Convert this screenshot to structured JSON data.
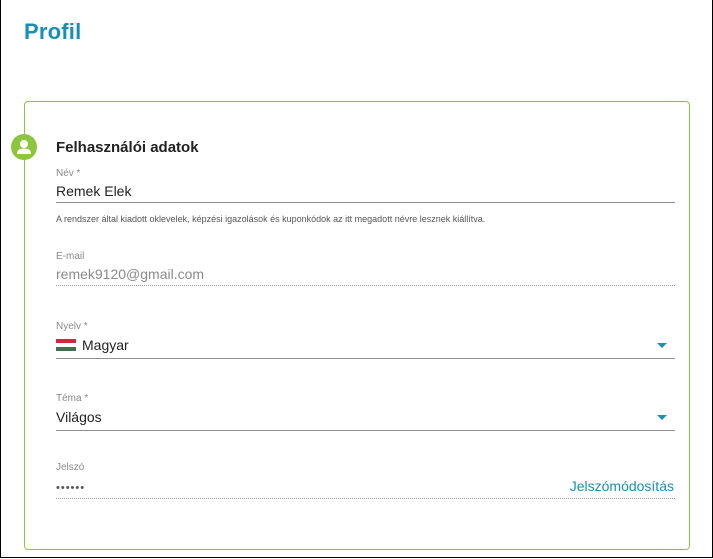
{
  "page": {
    "title": "Profil"
  },
  "section": {
    "title": "Felhasználói adatok",
    "icon": "user-icon"
  },
  "form": {
    "name": {
      "label": "Név *",
      "value": "Remek Elek",
      "hint": "A rendszer által kiadott oklevelek, képzési igazolások és kuponkódok az itt megadott névre lesznek kiállítva."
    },
    "email": {
      "label": "E-mail",
      "value": "remek9120@gmail.com"
    },
    "language": {
      "label": "Nyelv *",
      "value": "Magyar",
      "icon": "hungarian-flag-icon"
    },
    "theme": {
      "label": "Téma *",
      "value": "Világos"
    },
    "password": {
      "label": "Jelszó",
      "value": "••••••",
      "change_label": "Jelszómódosítás"
    }
  },
  "colors": {
    "accent": "#1a8fb5",
    "card_border": "#8cc63f",
    "avatar": "#8cc63f"
  }
}
